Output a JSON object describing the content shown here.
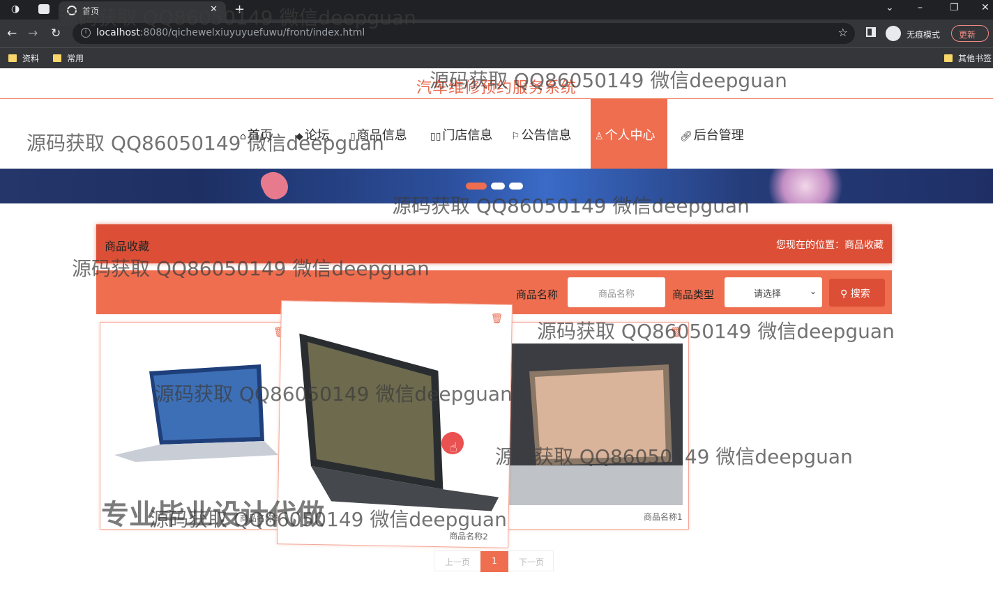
{
  "browser": {
    "tab_title": "首页",
    "url_host": "localhost",
    "url_rest": ":8080/qichewelxiuyuyuefuwu/front/index.html",
    "incognito_label": "无痕模式",
    "update_label": "更新",
    "bookmarks": [
      "资料",
      "常用"
    ],
    "other_bookmarks": "其他书签"
  },
  "site": {
    "title": "汽车维修预约服务系统",
    "menu": [
      {
        "label": "首页",
        "icon": "home-icon"
      },
      {
        "label": "论坛",
        "icon": "graduation-icon"
      },
      {
        "label": "商品信息",
        "icon": "document-icon"
      },
      {
        "label": "门店信息",
        "icon": "book-icon"
      },
      {
        "label": "公告信息",
        "icon": "flag-icon"
      },
      {
        "label": "个人中心",
        "icon": "user-icon",
        "active": true
      },
      {
        "label": "后台管理",
        "icon": "link-icon"
      }
    ]
  },
  "breadcrumb": {
    "title": "商品收藏",
    "position": "您现在的位置：商品收藏"
  },
  "search": {
    "name_label": "商品名称",
    "name_placeholder": "商品名称",
    "type_label": "商品类型",
    "type_selected": "请选择",
    "button_label": "搜索"
  },
  "products": [
    {
      "name": "商品名称3"
    },
    {
      "name": "商品名称2"
    },
    {
      "name": "商品名称1"
    }
  ],
  "pagination": {
    "prev": "上一页",
    "current": "1",
    "next": "下一页"
  },
  "watermarks": {
    "text": "源码获取 QQ86050149 微信deepguan",
    "big": "专业毕业设计代做"
  },
  "colors": {
    "accent": "#ee6e4f",
    "accent_dark": "#dc4f36"
  }
}
